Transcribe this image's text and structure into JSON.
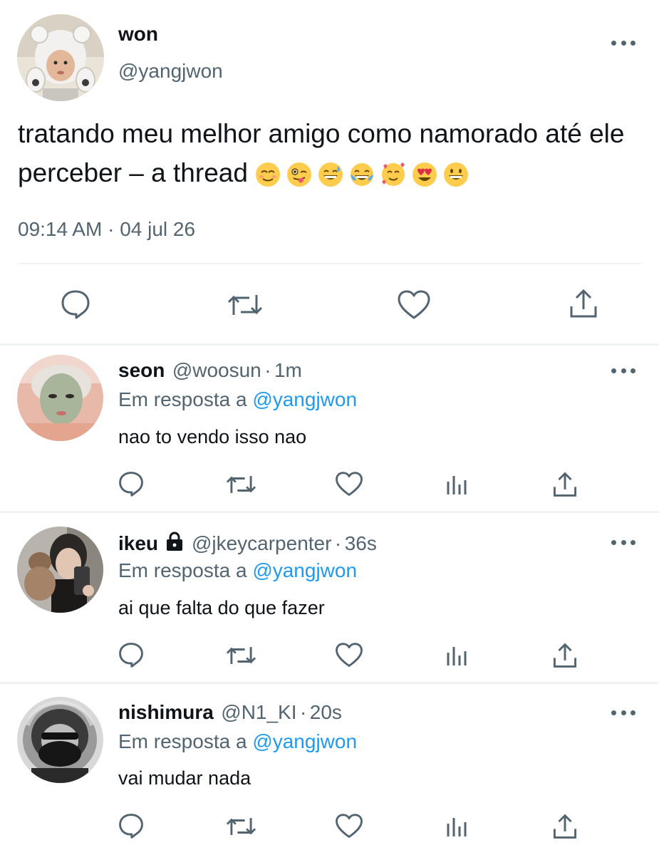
{
  "main_tweet": {
    "name": "won",
    "handle": "@yangjwon",
    "text": "tratando meu melhor amigo como namorado até ele perceber – a thread",
    "emojis": [
      "relieved-face",
      "winking-tongue-face",
      "grinning-sweat-face",
      "tears-of-joy-face",
      "smiling-hearts-face",
      "heart-eyes-face",
      "grinning-face"
    ],
    "time": "09:14 AM",
    "separator": "·",
    "date": "04 jul 26"
  },
  "replies": [
    {
      "name": "seon",
      "handle": "@woosun",
      "age": "1m",
      "reply_prefix": "Em resposta a",
      "reply_mention": "@yangjwon",
      "text": "nao to vendo isso nao"
    },
    {
      "name": "ikeu",
      "handle": "@jkeycarpenter",
      "age": "36s",
      "reply_prefix": "Em resposta a",
      "reply_mention": "@yangjwon",
      "text": "ai que falta do que fazer"
    },
    {
      "name": "nishimura",
      "handle": "@N1_KI",
      "age": "20s",
      "reply_prefix": "Em resposta a",
      "reply_mention": "@yangjwon",
      "text": "vai mudar nada"
    }
  ],
  "colors": {
    "text": "#0f1419",
    "secondary": "#536471",
    "link": "#1d9bf0",
    "divider": "#eff3f4"
  }
}
